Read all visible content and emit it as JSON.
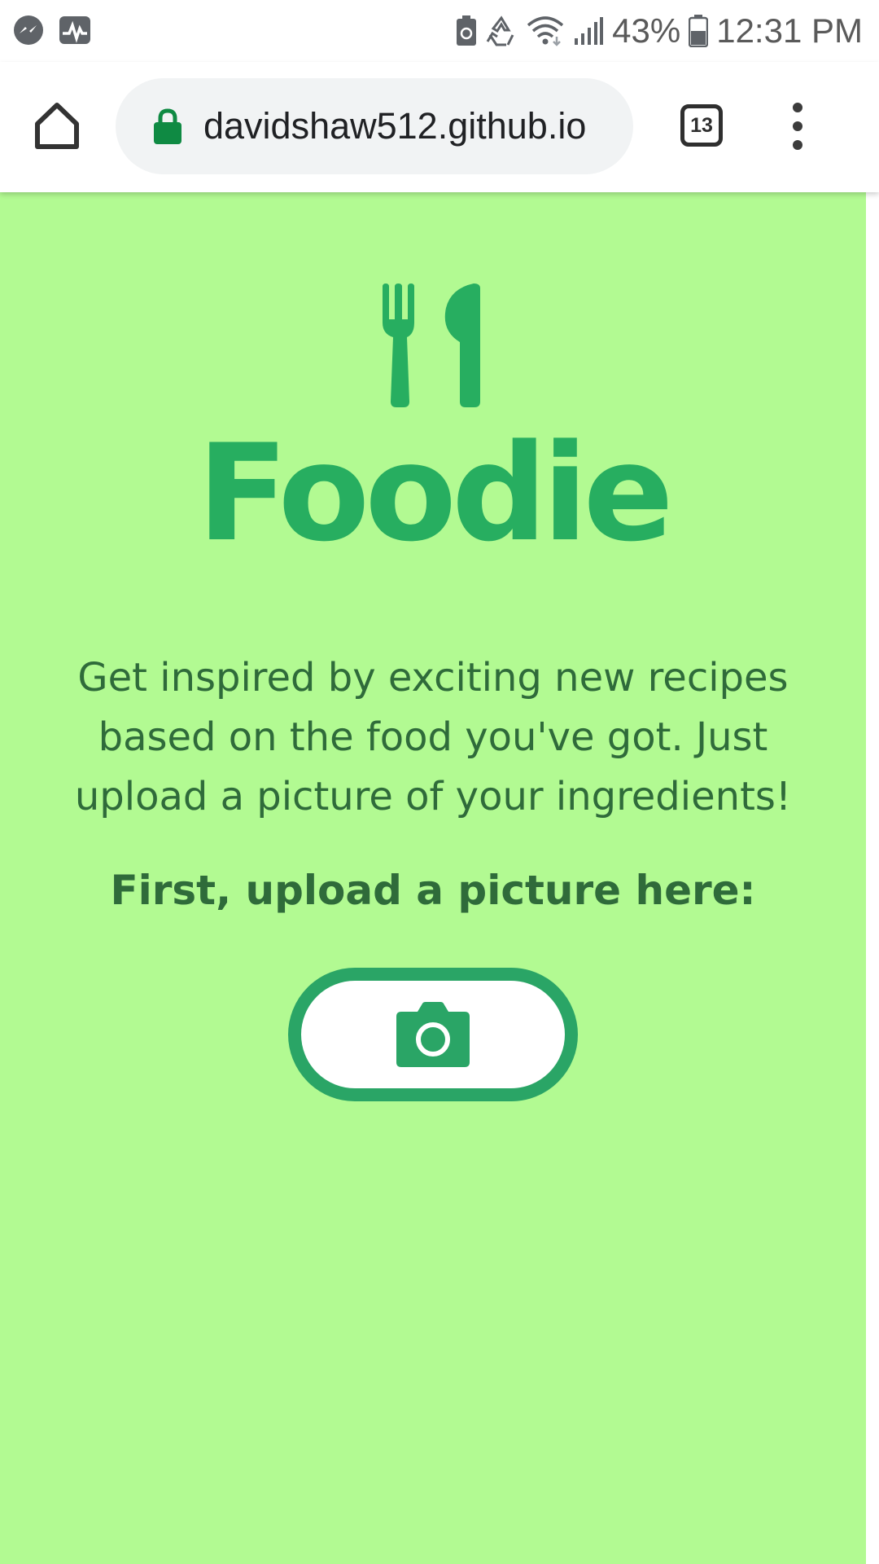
{
  "status_bar": {
    "battery_percent": "43%",
    "time": "12:31 PM",
    "icons": [
      "messenger-icon",
      "activity-icon",
      "battery-saver-icon",
      "recycle-icon",
      "wifi-icon",
      "signal-icon",
      "battery-icon"
    ]
  },
  "browser": {
    "url": "davidshaw512.github.io",
    "tab_count": "13",
    "icons": [
      "home-icon",
      "lock-icon",
      "tabs-icon",
      "more-menu-icon"
    ]
  },
  "page": {
    "brand": "Foodie",
    "intro": "Get inspired by exciting new recipes based on the food you've got. Just upload a picture of your ingredients!",
    "upload_prompt": "First, upload a picture here:",
    "upload_button_icon": "camera-icon"
  },
  "colors": {
    "page_background": "#b2fa92",
    "brand_green": "#27ae60",
    "text_green": "#2f6b3a",
    "button_border": "#2aa566",
    "lock_green": "#0f8a43"
  }
}
